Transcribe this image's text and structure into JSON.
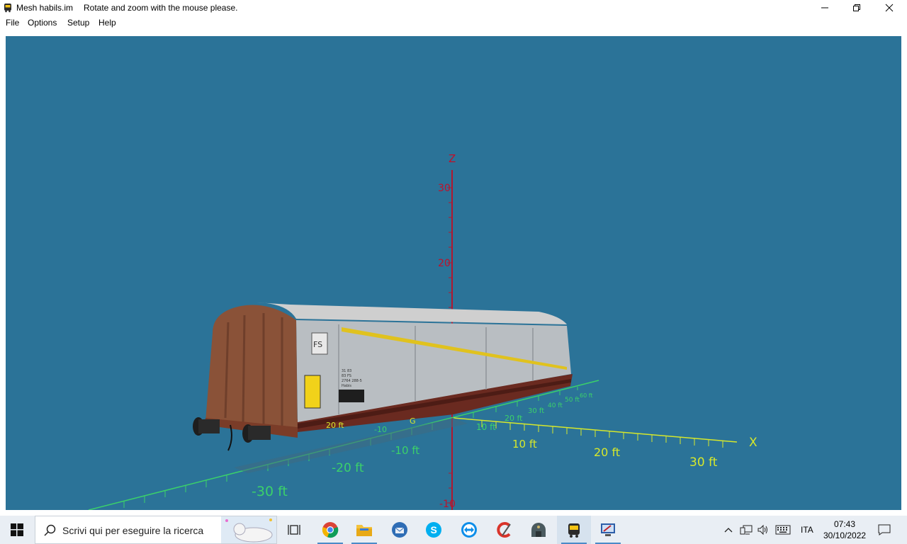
{
  "window": {
    "title": "Mesh habils.im",
    "hint": "Rotate and zoom with the mouse please.",
    "controls": [
      "minimize",
      "maximize",
      "close"
    ]
  },
  "menu": {
    "items": [
      "File",
      "Options",
      "Setup",
      "Help"
    ]
  },
  "viewport": {
    "background": "#2b7398",
    "z_axis": {
      "label": "Z",
      "ticks": [
        "30",
        "20",
        "-10"
      ]
    },
    "x_axis": {
      "label": "X",
      "ticks": [
        "10 ft",
        "20 ft",
        "30 ft"
      ]
    },
    "y_axis": {
      "ticks_near": [
        "-10 ft",
        "-20 ft",
        "-30 ft"
      ],
      "ticks_far": [
        "10 ft",
        "20 ft",
        "30 ft",
        "40 ft",
        "50 ft",
        "60 ft"
      ]
    },
    "partial_labels": [
      "20 ft",
      "-10",
      "G"
    ],
    "wagon": {
      "logo": "FS",
      "markings": [
        "31 83",
        "83 FS",
        "2764 288-5",
        "Habis"
      ],
      "colors": {
        "body": "#8a5238",
        "panels": "#b9bec2",
        "stripe": "#e0c21e",
        "underframe": "#6a2a20"
      }
    },
    "axis_colors": {
      "z": "#c0102a",
      "x": "#d7e82b",
      "y": "#3bd16a"
    }
  },
  "taskbar": {
    "search_placeholder": "Scrivi qui per eseguire la ricerca",
    "apps": [
      "task-view",
      "chrome",
      "file-explorer",
      "thunderbird",
      "skype",
      "teamviewer",
      "ccleaner",
      "trainz-terminal",
      "mesh-viewer",
      "remote-desktop"
    ],
    "language": "ITA",
    "time": "07:43",
    "date": "30/10/2022"
  }
}
